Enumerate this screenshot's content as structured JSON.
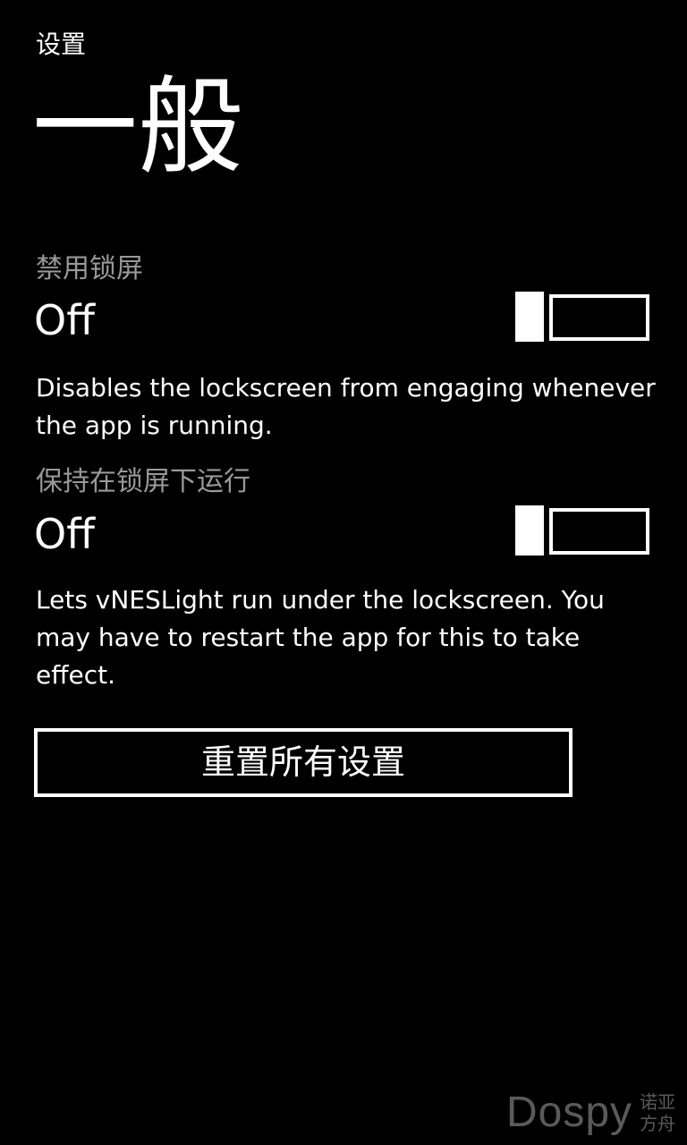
{
  "app_title": "设置",
  "page_title": "一般",
  "settings": [
    {
      "header": "禁用锁屏",
      "value": "Off",
      "toggle_on": false,
      "description": "Disables the lockscreen from engaging whenever the app is running."
    },
    {
      "header": "保持在锁屏下运行",
      "value": "Off",
      "toggle_on": false,
      "description": "Lets vNESLight run under the lockscreen. You may have to restart the app for this to take effect."
    }
  ],
  "reset_button_label": "重置所有设置",
  "watermark": {
    "text": "Dospy",
    "sub_line1": "诺亚",
    "sub_line2": "方舟"
  },
  "colors": {
    "background": "#000000",
    "foreground": "#ffffff",
    "subtle": "#999999"
  }
}
